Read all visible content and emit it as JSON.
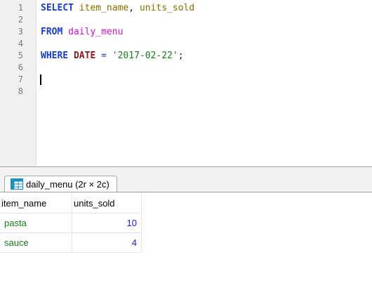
{
  "editor": {
    "line_numbers": [
      "1",
      "2",
      "3",
      "4",
      "5",
      "6",
      "7",
      "8"
    ],
    "line1": {
      "kw_select": "SELECT",
      "col1": "item_name",
      "comma": ",",
      "col2": "units_sold"
    },
    "line3": {
      "kw_from": "FROM",
      "table": "daily_menu"
    },
    "line5": {
      "kw_where": "WHERE",
      "fn_date": "DATE",
      "op": "=",
      "value": "'2017-02-22'",
      "semi": ";"
    }
  },
  "result_tab": {
    "label": "daily_menu (2r × 2c)",
    "icon": "table-grid-icon"
  },
  "grid": {
    "columns": [
      "item_name",
      "units_sold"
    ],
    "rows": [
      {
        "item_name": "pasta",
        "units_sold": "10"
      },
      {
        "item_name": "sauce",
        "units_sold": "4"
      }
    ]
  },
  "colors": {
    "keyword": "#1a3cc8",
    "function": "#8b1a1a",
    "identifier": "#8a6d00",
    "table": "#c418c4",
    "string": "#1e7a1e",
    "text_cell": "#1a7a1a",
    "number_cell": "#1a1ad0"
  }
}
